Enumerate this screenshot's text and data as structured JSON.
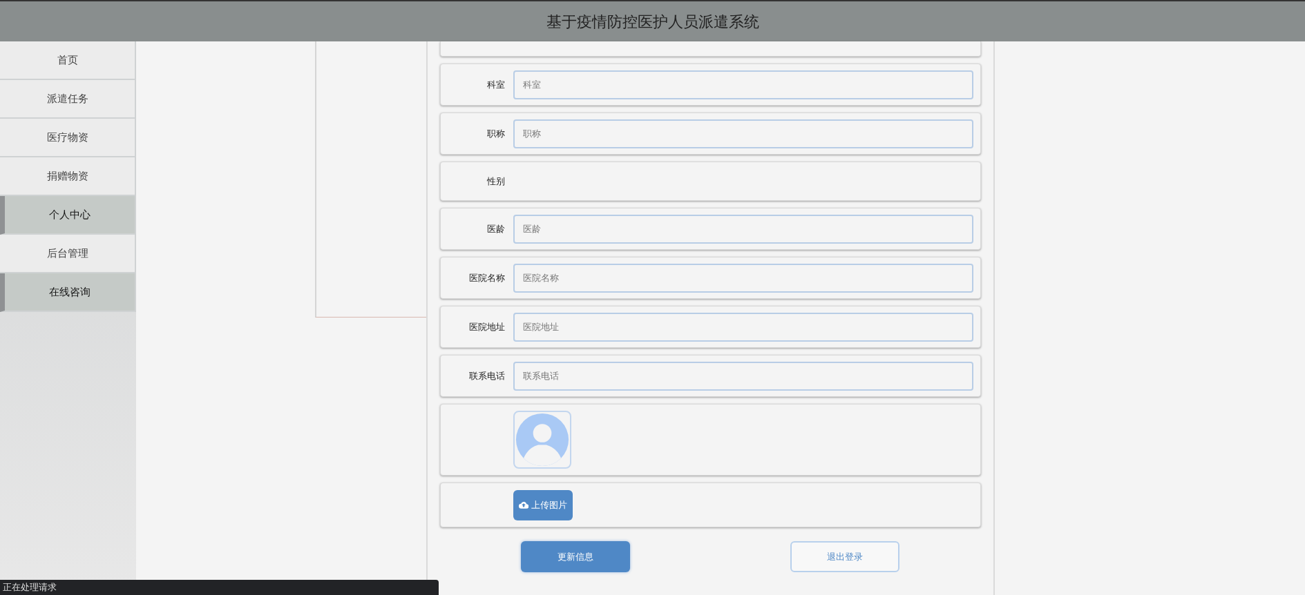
{
  "header": {
    "title": "基于疫情防控医护人员派遣系统"
  },
  "sidebar": {
    "items": [
      {
        "label": "首页",
        "selected": false
      },
      {
        "label": "派遣任务",
        "selected": false
      },
      {
        "label": "医疗物资",
        "selected": false
      },
      {
        "label": "捐赠物资",
        "selected": false
      },
      {
        "label": "个人中心",
        "selected": true
      },
      {
        "label": "后台管理",
        "selected": false
      },
      {
        "label": "在线咨询",
        "selected": true
      }
    ]
  },
  "form": {
    "rows": [
      {
        "kind": "input",
        "label": "科室",
        "placeholder": "科室"
      },
      {
        "kind": "input",
        "label": "职称",
        "placeholder": "职称"
      },
      {
        "kind": "text",
        "label": "性别"
      },
      {
        "kind": "input",
        "label": "医龄",
        "placeholder": "医龄"
      },
      {
        "kind": "input",
        "label": "医院名称",
        "placeholder": "医院名称"
      },
      {
        "kind": "input",
        "label": "医院地址",
        "placeholder": "医院地址"
      },
      {
        "kind": "input",
        "label": "联系电话",
        "placeholder": "联系电话"
      },
      {
        "kind": "avatar"
      },
      {
        "kind": "upload",
        "button": "上传图片"
      }
    ],
    "buttons": [
      {
        "kind": "primary",
        "label": "更新信息"
      },
      {
        "kind": "outline",
        "label": "退出登录"
      }
    ]
  },
  "status_bar": {
    "text": "正在处理请求"
  }
}
